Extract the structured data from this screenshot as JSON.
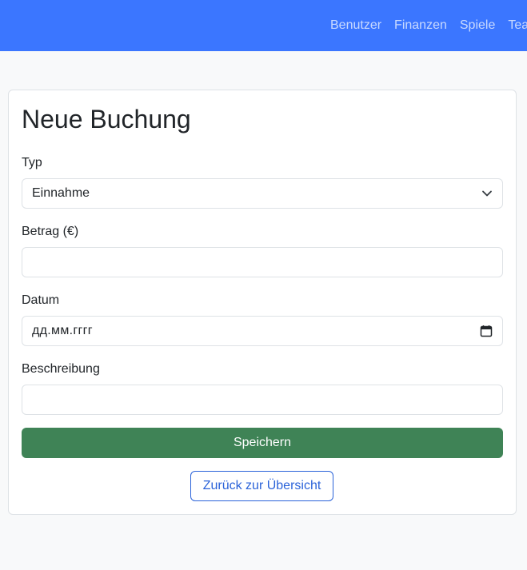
{
  "nav": {
    "links": [
      "Benutzer",
      "Finanzen",
      "Spiele",
      "Teams"
    ]
  },
  "form": {
    "title": "Neue Buchung",
    "type_label": "Typ",
    "type_value": "Einnahme",
    "amount_label": "Betrag (€)",
    "amount_value": "",
    "date_label": "Datum",
    "date_placeholder": "дд.мм.гггг",
    "description_label": "Beschreibung",
    "description_value": "",
    "save_label": "Speichern",
    "back_label": "Zurück zur Übersicht"
  },
  "colors": {
    "navbar": "#3b76ff",
    "save_button": "#3f8356",
    "back_button_border": "#2b63d9"
  },
  "icons": {
    "select": "chevron-down-icon",
    "date": "calendar-icon"
  }
}
